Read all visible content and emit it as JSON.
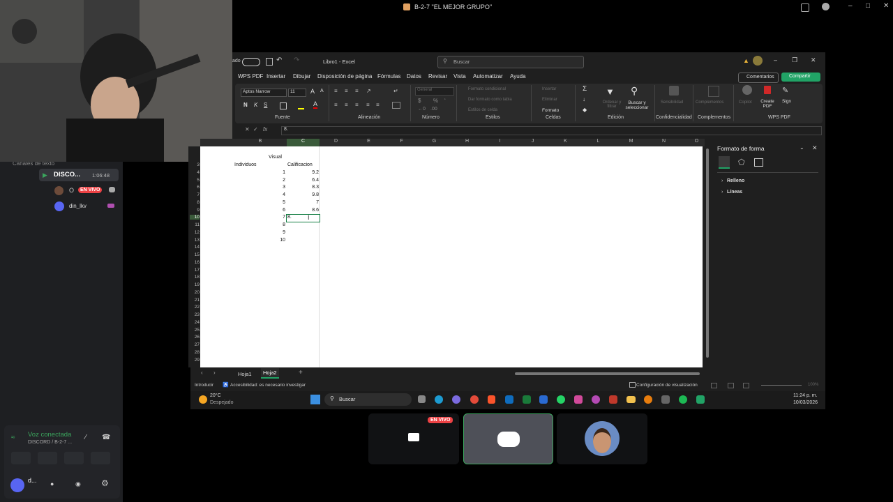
{
  "window": {
    "title": "B-2-7 \"EL MEJOR GRUPO\""
  },
  "sidebar": {
    "channels_header": "Canales de texto",
    "voice_channel": "DISCO...",
    "stream_time": "1:06:48",
    "user1": {
      "prefix": "O",
      "badge": "EN VIVO"
    },
    "user2": {
      "name": "din_lkv"
    },
    "voice_status": "Voz conectada",
    "voice_sub": "DISCORD / B-2-7 ...",
    "self_name": "d..."
  },
  "excel": {
    "doc_title": "Libro1 - Excel",
    "search_placeholder": "Buscar",
    "title_prefix": "ado",
    "tabs": [
      "WPS PDF",
      "Insertar",
      "Dibujar",
      "Disposición de página",
      "Fórmulas",
      "Datos",
      "Revisar",
      "Vista",
      "Automatizar",
      "Ayuda"
    ],
    "comments_btn": "Comentarios",
    "share_btn": "Compartir",
    "font_name": "Aptos Narrow",
    "font_size": "11",
    "number_format": "General",
    "groups": {
      "fuente": "Fuente",
      "alineacion": "Alineación",
      "numero": "Número",
      "estilos": "Estilos",
      "celdas": "Celdas",
      "edicion": "Edición",
      "confidencialidad": "Confidencialidad",
      "complementos": "Complementos",
      "wps": "WPS PDF"
    },
    "ribbon_labels": {
      "fmt_cond": "Formato condicional",
      "dar_formato": "Dar formato como tabla",
      "estilos_celda": "Estilos de celda",
      "insertar": "Insertar",
      "eliminar": "Eliminar",
      "formato": "Formato",
      "ordenar": "Ordenar y filtrar",
      "buscar": "Buscar y seleccionar",
      "sensibilidad": "Sensibilidad",
      "complementos": "Complementos",
      "copilot": "Copilot",
      "create_pdf": "Create PDF",
      "sign": "Sign"
    },
    "formula_bar": {
      "value": "8."
    },
    "columns": [
      "B",
      "C",
      "D",
      "E",
      "F",
      "G",
      "H",
      "I",
      "J",
      "K",
      "L",
      "M",
      "N",
      "O"
    ],
    "rows": [
      "3",
      "4",
      "5",
      "6",
      "7",
      "8",
      "9",
      "10",
      "11",
      "12",
      "13",
      "14",
      "15",
      "16",
      "17",
      "18",
      "19",
      "20",
      "21",
      "22",
      "23",
      "24",
      "25",
      "26",
      "27",
      "28",
      "29"
    ],
    "header_visual": "Visual",
    "header_individuos": "Individuos",
    "header_calificacion": "Calificacion",
    "individuos": [
      "1",
      "2",
      "3",
      "4",
      "5",
      "6",
      "7",
      "8",
      "9",
      "10"
    ],
    "calificaciones": [
      "9.2",
      "6.4",
      "8.3",
      "9.8",
      "7",
      "8.6"
    ],
    "editing_value": "8.",
    "sheets": [
      "Hoja1",
      "Hoja2"
    ],
    "active_sheet": "Hoja2",
    "status_left": "Introducir",
    "status_access": "Accesibilidad: es necesario investigar",
    "status_view": "Configuración de visualización",
    "zoom": "100%"
  },
  "panel": {
    "title": "Formato de forma",
    "items": [
      "Relleno",
      "Líneas"
    ]
  },
  "taskbar": {
    "temp": "20°C",
    "weather": "Despejado",
    "search": "Buscar",
    "time": "11:24 p. m.",
    "date": "10/03/2026"
  },
  "stream": {
    "live_badge": "EN VIVO"
  },
  "colors": {
    "excel_green": "#21a366",
    "live_red": "#ed4245",
    "discord_blue": "#5865f2",
    "cell_border": "#107c41"
  }
}
